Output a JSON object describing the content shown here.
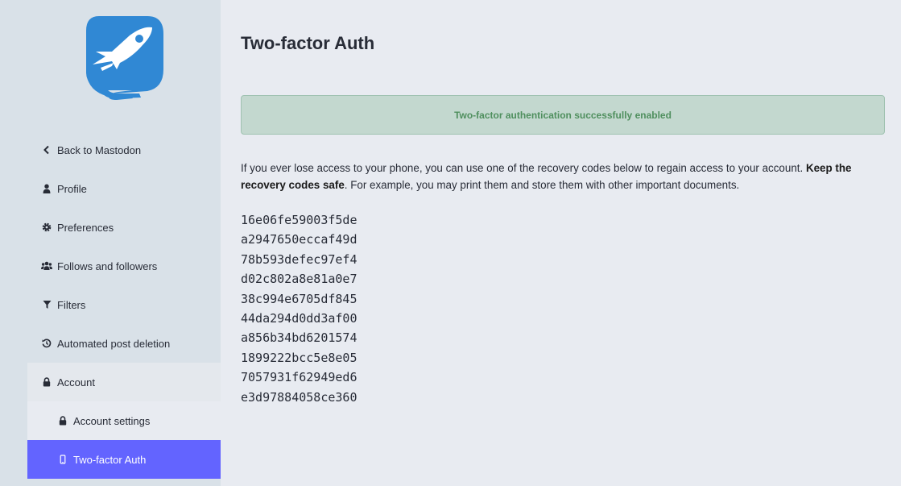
{
  "logo": {
    "name": "mastodon-logo-icon"
  },
  "sidebar": {
    "items": [
      {
        "label": "Back to Mastodon",
        "icon": "chevron-left-icon"
      },
      {
        "label": "Profile",
        "icon": "user-icon"
      },
      {
        "label": "Preferences",
        "icon": "gear-icon"
      },
      {
        "label": "Follows and followers",
        "icon": "users-icon"
      },
      {
        "label": "Filters",
        "icon": "filter-icon"
      },
      {
        "label": "Automated post deletion",
        "icon": "history-icon"
      },
      {
        "label": "Account",
        "icon": "lock-icon"
      },
      {
        "label": "Account settings",
        "icon": "lock-icon"
      },
      {
        "label": "Two-factor Auth",
        "icon": "mobile-icon"
      }
    ]
  },
  "main": {
    "title": "Two-factor Auth",
    "alert": "Two-factor authentication successfully enabled",
    "info_before": "If you ever lose access to your phone, you can use one of the recovery codes below to regain access to your account. ",
    "info_strong": "Keep the recovery codes safe",
    "info_after": ". For example, you may print them and store them with other important documents.",
    "recovery_codes": [
      "16e06fe59003f5de",
      "a2947650eccaf49d",
      "78b593defec97ef4",
      "d02c802a8e81a0e7",
      "38c994e6705df845",
      "44da294d0dd3af00",
      "a856b34bd6201574",
      "1899222bcc5e8e05",
      "7057931f62949ed6",
      "e3d97884058ce360"
    ]
  },
  "colors": {
    "sidebar_bg": "#d9e1e8",
    "page_bg": "#e8ebf1",
    "active": "#6364ff",
    "alert_bg": "#c3d8cf",
    "alert_text": "#4f8f5e",
    "brand": "#3088d4"
  }
}
